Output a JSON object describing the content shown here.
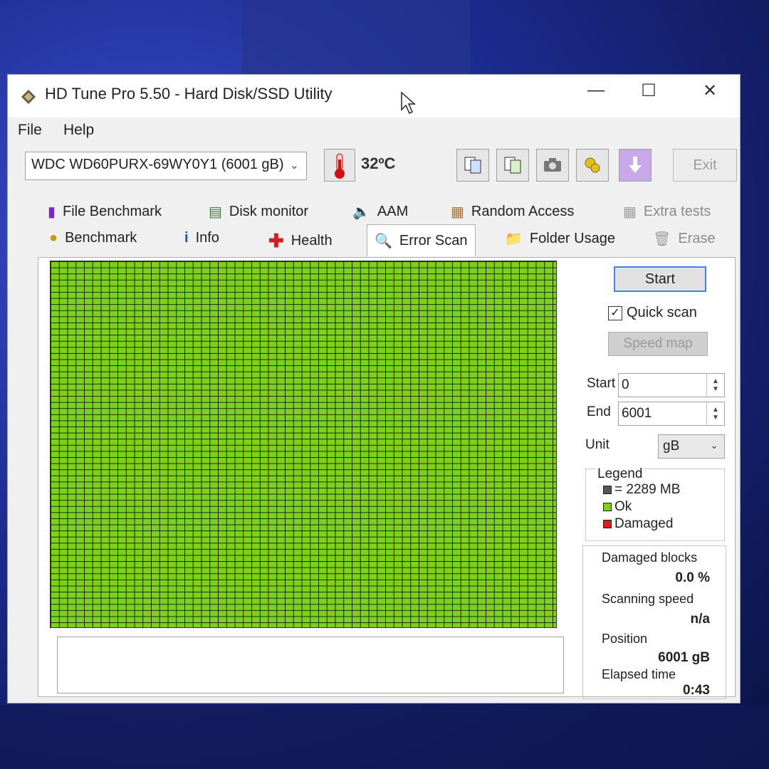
{
  "window": {
    "title": "HD Tune Pro 5.50 - Hard Disk/SSD Utility",
    "controls": {
      "minimize": "—",
      "maximize": "☐",
      "close": "✕"
    }
  },
  "menu": {
    "items": [
      "File",
      "Help"
    ]
  },
  "toolbar": {
    "drive": "WDC WD60PURX-69WY0Y1 (6001 gB)",
    "temperature": "32ºC",
    "exit_label": "Exit",
    "buttons": [
      "copy-info",
      "copy-text",
      "screenshot",
      "options",
      "download"
    ]
  },
  "tabs": {
    "row1": [
      "File Benchmark",
      "Disk monitor",
      "AAM",
      "Random Access",
      "Extra tests"
    ],
    "row2": [
      "Benchmark",
      "Info",
      "Health",
      "Error Scan",
      "Folder Usage",
      "Erase"
    ],
    "active": "Error Scan"
  },
  "error_scan": {
    "start_button": "Start",
    "quick_scan_label": "Quick scan",
    "quick_scan_checked": true,
    "speed_map_button": "Speed map",
    "start_label": "Start",
    "start_value": "0",
    "end_label": "End",
    "end_value": "6001",
    "unit_label": "Unit",
    "unit_value": "gB",
    "legend": {
      "title": "Legend",
      "block_size": "= 2289 MB",
      "ok": "Ok",
      "damaged": "Damaged"
    },
    "stats": {
      "damaged_blocks_label": "Damaged blocks",
      "damaged_blocks_value": "0.0 %",
      "scanning_speed_label": "Scanning speed",
      "scanning_speed_value": "n/a",
      "position_label": "Position",
      "position_value": "6001 gB",
      "elapsed_label": "Elapsed time",
      "elapsed_value": "0:43"
    }
  },
  "colors": {
    "ok_block": "#7cd11d",
    "damaged_block": "#d62020",
    "size_block": "#555555",
    "accent": "#4a7ee0"
  }
}
